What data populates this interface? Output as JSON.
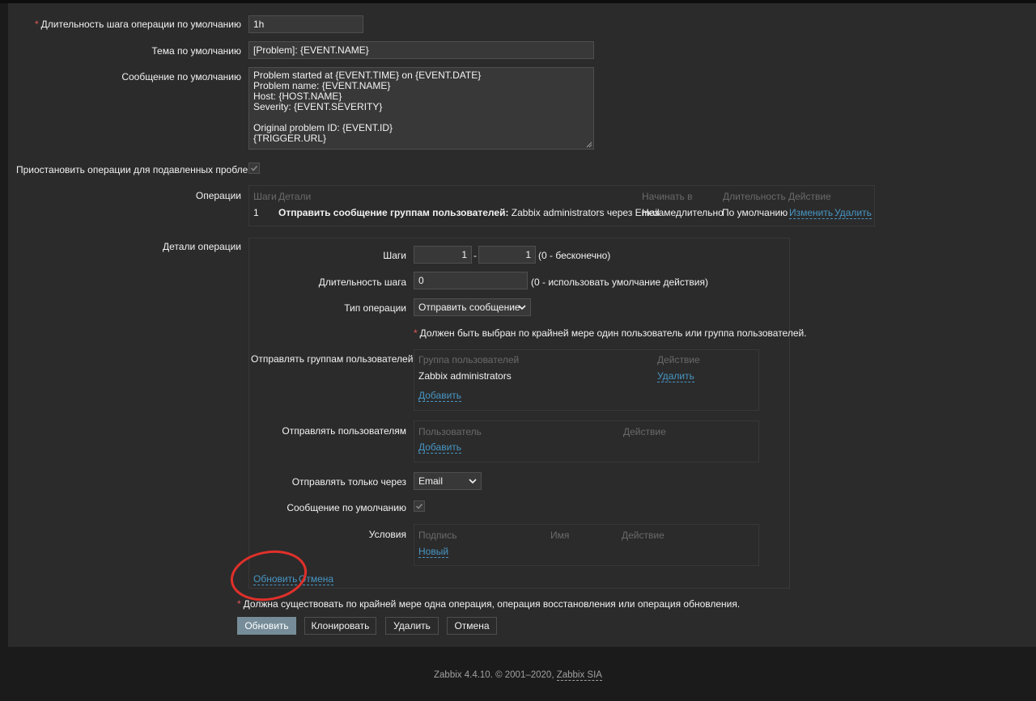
{
  "colors": {
    "background": "#1b1b1b",
    "panel": "#2b2b2b",
    "input_bg": "#383838",
    "link": "#4796c4",
    "required_marker": "#e45959",
    "primary_button": "#768d99",
    "annotation_circle": "#e0302a"
  },
  "form": {
    "required_marker": "*",
    "default_step_duration": {
      "label": "Длительность шага операции по умолчанию",
      "value": "1h"
    },
    "default_subject": {
      "label": "Тема по умолчанию",
      "value": "[Problem]: {EVENT.NAME}"
    },
    "default_message": {
      "label": "Сообщение по умолчанию",
      "lines": [
        "Problem started at {EVENT.TIME} on {EVENT.DATE}",
        "Problem name: {EVENT.NAME}",
        "Host: {HOST.NAME}",
        "Severity: {EVENT.SEVERITY}",
        "",
        "Original problem ID: {EVENT.ID}",
        "{TRIGGER.URL}"
      ]
    },
    "pause_suppressed": {
      "label": "Приостановить операции для подавленных проблем",
      "checked": true
    },
    "operations": {
      "label": "Операции",
      "headers": [
        "Шаги",
        "Детали",
        "Начинать в",
        "Длительность",
        "Действие"
      ],
      "rows": [
        {
          "steps": "1",
          "details_bold": "Отправить сообщение группам пользователей:",
          "details_rest": " Zabbix administrators через Email",
          "start_in": "Незамедлительно",
          "duration": "По умолчанию",
          "edit": "Изменить",
          "remove": "Удалить"
        }
      ]
    }
  },
  "operation_details": {
    "label": "Детали операции",
    "steps": {
      "label": "Шаги",
      "from": "1",
      "separator": "-",
      "to": "1",
      "hint": "(0 - бесконечно)"
    },
    "step_duration": {
      "label": "Длительность шага",
      "value": "0",
      "hint": "(0 - использовать умолчание действия)"
    },
    "operation_type": {
      "label": "Тип операции",
      "value": "Отправить сообщение"
    },
    "warning": "Должен быть выбран по крайней мере один пользователь или группа пользователей.",
    "send_to_groups": {
      "label": "Отправлять группам пользователей",
      "col_group": "Группа пользователей",
      "col_action": "Действие",
      "rows": [
        {
          "name": "Zabbix administrators",
          "action": "Удалить"
        }
      ],
      "add": "Добавить"
    },
    "send_to_users": {
      "label": "Отправлять пользователям",
      "col_user": "Пользователь",
      "col_action": "Действие",
      "add": "Добавить"
    },
    "send_only_to": {
      "label": "Отправлять только через",
      "value": "Email"
    },
    "default_message": {
      "label": "Сообщение по умолчанию",
      "checked": true
    },
    "conditions": {
      "label": "Условия",
      "col_label": "Подпись",
      "col_name": "Имя",
      "col_action": "Действие",
      "add": "Новый"
    },
    "update_link": "Обновить",
    "cancel_link": "Отмена"
  },
  "bottom": {
    "warning": "Должна существовать по крайней мере одна операция, операция восстановления или операция обновления.",
    "buttons": {
      "update": "Обновить",
      "clone": "Клонировать",
      "delete": "Удалить",
      "cancel": "Отмена"
    }
  },
  "footer": {
    "text": "Zabbix 4.4.10. © 2001–2020, ",
    "company": "Zabbix SIA"
  }
}
